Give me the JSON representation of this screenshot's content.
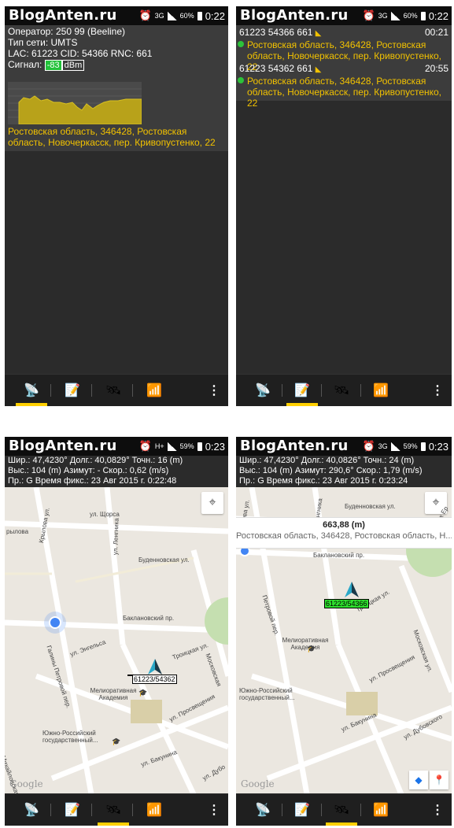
{
  "app": {
    "logo": "BlogAnten.ru"
  },
  "screens": [
    {
      "status": {
        "network": "3G",
        "battery": "60%",
        "time": "0:22"
      },
      "operator": "Оператор: 250 99 (Beeline)",
      "net_type": "Тип сети: UMTS",
      "lac_row": "LAC: 61223 CID: 54366 RNC: 661",
      "signal_label": "Сигнал:",
      "signal_value": "-83",
      "signal_unit": "dBm",
      "address": "Ростовская область, 346428, Ростовская область, Новочеркасск, пер. Кривопустенко, 22"
    },
    {
      "status": {
        "network": "3G",
        "battery": "60%",
        "time": "0:22"
      },
      "cells": [
        {
          "id": "61223 54366 661",
          "time": "00:21",
          "address": "Ростовская область, 346428, Ростовская область, Новочеркасск, пер. Кривопустенко, 22"
        },
        {
          "id": "61223 54362 661",
          "time": "20:55",
          "address": "Ростовская область, 346428, Ростовская область, Новочеркасск, пер. Кривопустенко, 22"
        }
      ]
    },
    {
      "status": {
        "network": "H+",
        "battery": "59%",
        "time": "0:23"
      },
      "row1": "Шир.: 47,4230° Долг.: 40,0829° Точн.: 16 (m)",
      "row2": "Выс.: 104 (m) Азимут: - Скор.: 0,62 (m/s)",
      "row3": "Пр.: G Время фикс.: 23 Авг 2015 г. 0:22:48",
      "cell_tag": "61223/54362",
      "streets": {
        "s1": "ул. Щорса",
        "s2": "рылова",
        "s3": "Крылова ул.",
        "s4": "ул. Ленгника",
        "s5": "Буденновская ул.",
        "s6": "Баклановский пр.",
        "s7": "ул. Энгельса",
        "s8": "Галины Петровой пер.",
        "s9": "Мелиоративная Академия",
        "s10": "Троицкая ул.",
        "s11": "Московская",
        "s12": "ул. Просвещения",
        "s13": "Южно-Российский государственный...",
        "s14": "ул. Бакунина",
        "s15": "Михайловская ул.",
        "s16": "ул. Дубо"
      },
      "google": "Google"
    },
    {
      "status": {
        "network": "3G",
        "battery": "59%",
        "time": "0:23"
      },
      "row1": "Шир.: 47,4230° Долг.: 40,0826° Точн.: 24 (m)",
      "row2": "Выс.: 104 (m) Азимут: 290,6° Скор.: 1,79 (m/s)",
      "row3": "Пр.: G Время фикс.: 23 Авг 2015 г. 0:23:24",
      "distance": "663,88 (m)",
      "bubble_address": "Ростовская область, 346428, Ростовская область, Н...",
      "cell_tag": "61223/54366",
      "streets": {
        "s1": "Крылова ул.",
        "s2": "ул. Ленгника",
        "s3": "Буденновская ул.",
        "s4": "ул. спуск Ер",
        "s5": "Баклановский пр.",
        "s6": "Троицкая ул.",
        "s7": "Петровой пер.",
        "s8": "Мелиоративная Академия",
        "s9": "Московская ул.",
        "s10": "ул. Просвещения",
        "s11": "Южно-Российский государственный...",
        "s12": "ул. Бакунина",
        "s13": "ул. Дубовского"
      },
      "google": "Google"
    }
  ],
  "nav": {
    "menu": "⋮"
  },
  "icons": {
    "tower": "tower-icon",
    "cells": "cell-list-icon",
    "map": "map-satellite-icon",
    "wifi": "wifi-icon"
  },
  "colors": {
    "accent": "#ffd000",
    "address": "#f2c200",
    "signal": "#22c23a"
  }
}
